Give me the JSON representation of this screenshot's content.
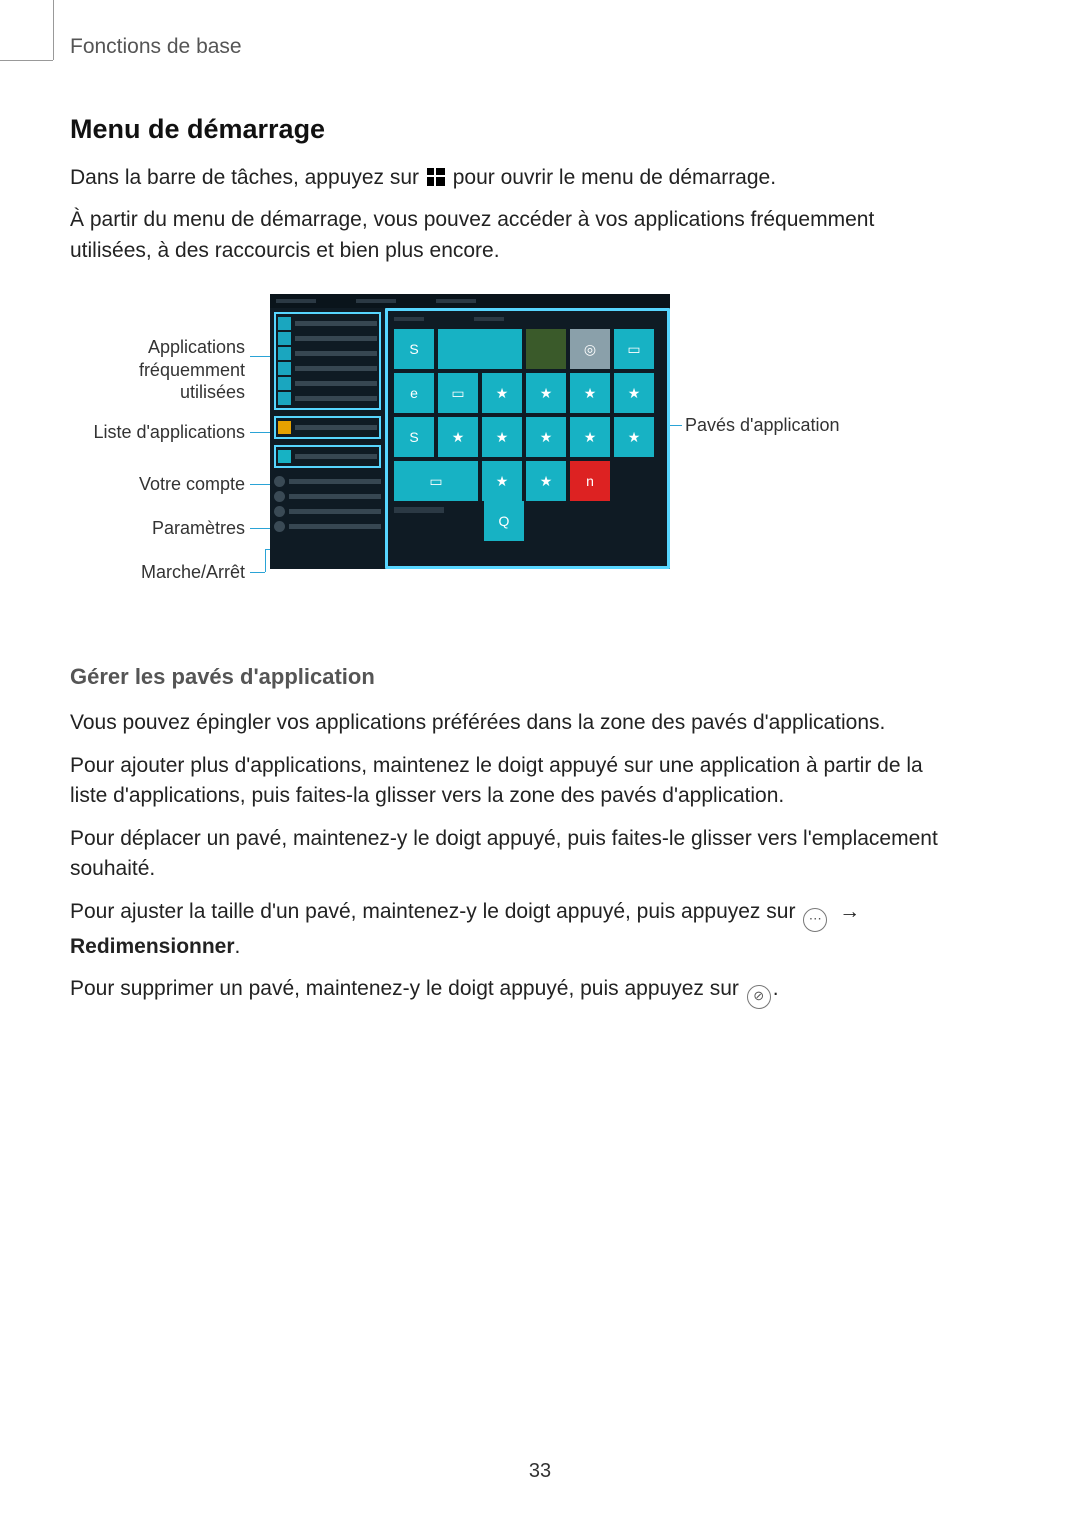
{
  "running_head": "Fonctions de base",
  "h2": "Menu de démarrage",
  "p1a": "Dans la barre de tâches, appuyez sur ",
  "p1b": " pour ouvrir le menu de démarrage.",
  "p2": "À partir du menu de démarrage, vous pouvez accéder à vos applications fréquemment utilisées, à des raccourcis et bien plus encore.",
  "callouts": {
    "freq1": "Applications",
    "freq2": "fréquemment utilisées",
    "apps_list": "Liste d'applications",
    "account": "Votre compte",
    "settings": "Paramètres",
    "power": "Marche/Arrêt",
    "tiles": "Pavés d'application"
  },
  "h3": "Gérer les pavés d'application",
  "p3": "Vous pouvez épingler vos applications préférées dans la zone des pavés d'applications.",
  "p4": "Pour ajouter plus d'applications, maintenez le doigt appuyé sur une application à partir de la liste d'applications, puis faites-la glisser vers la zone des pavés d'application.",
  "p5": "Pour déplacer un pavé, maintenez-y le doigt appuyé, puis faites-le glisser vers l'emplacement souhaité.",
  "p6a": "Pour ajuster la taille d'un pavé, maintenez-y le doigt appuyé, puis appuyez sur ",
  "p6_arrow": "→",
  "p6_bold": "Redimensionner",
  "p6_end": ".",
  "p7a": "Pour supprimer un pavé, maintenez-y le doigt appuyé, puis appuyez sur ",
  "p7_end": ".",
  "more_icon_glyph": "⋯",
  "unpin_icon_glyph": "⊘",
  "page_number": "33"
}
